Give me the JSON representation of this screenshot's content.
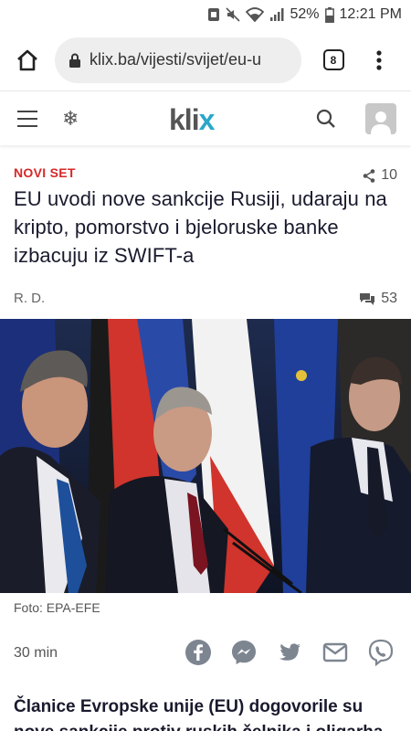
{
  "status_bar": {
    "battery": "52%",
    "time": "12:21 PM"
  },
  "browser": {
    "url": "klix.ba/vijesti/svijet/eu-u",
    "tab_count": "8"
  },
  "site": {
    "logo_text": "kli",
    "logo_x": "x"
  },
  "article": {
    "kicker": "NOVI SET",
    "share_count": "10",
    "headline": "EU uvodi nove sankcije Rusiji, udaraju na kripto, pomorstvo i bjeloruske banke izbacuju iz SWIFT-a",
    "author": "R. D.",
    "comment_count": "53",
    "photo_caption": "Foto: EPA-EFE",
    "time_ago": "30 min",
    "lead": "Članice Evropske unije (EU) dogovorile su nove sankcije protiv ruskih čelnika i oligarha"
  },
  "share_icons": [
    "facebook-icon",
    "messenger-icon",
    "twitter-icon",
    "email-icon",
    "viber-icon"
  ]
}
